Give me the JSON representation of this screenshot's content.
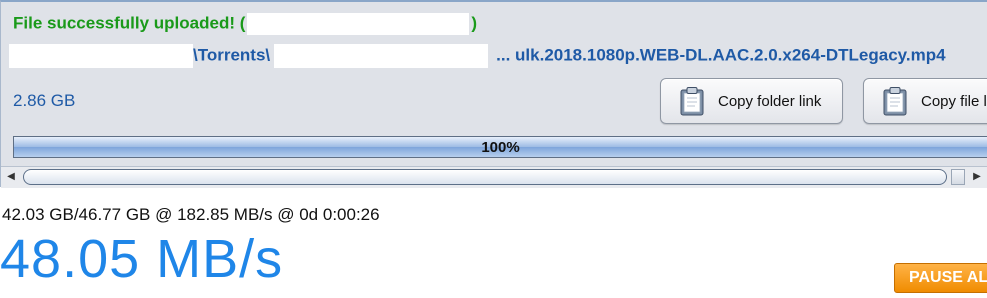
{
  "upload": {
    "success_prefix": "File successfully uploaded! (",
    "success_suffix": ")",
    "path_folder": "\\Torrents\\",
    "path_file": "... ulk.2018.1080p.WEB-DL.AAC.2.0.x264-DTLegacy.mp4",
    "size": "2.86 GB"
  },
  "buttons": {
    "copy_folder_link": "Copy folder link",
    "copy_file_link": "Copy file link",
    "pause_all": "PAUSE ALL"
  },
  "progress": {
    "value": 1.0,
    "label": "100%"
  },
  "stats": {
    "transfer": "42.03 GB/46.77 GB @ 182.85 MB/s @ 0d 0:00:26",
    "speed": "48.05 MB/s"
  },
  "icons": {
    "copy_folder": "clipboard-icon",
    "copy_file": "clipboard-icon",
    "scroll_left": "chevron-left-icon",
    "scroll_right": "chevron-right-icon"
  },
  "colors": {
    "success": "#1a9a1a",
    "path": "#1f5aa6",
    "speed": "#1f86e8",
    "pause": "#f08c00"
  }
}
